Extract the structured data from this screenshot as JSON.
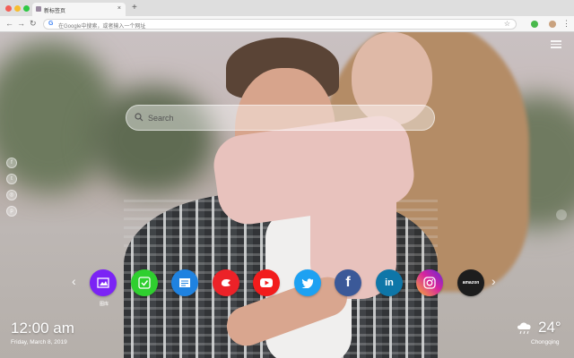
{
  "browser": {
    "tab_title": "新标签页",
    "tab_close": "×",
    "new_tab": "+",
    "back": "←",
    "forward": "→",
    "reload": "↻",
    "omnibox_placeholder": "在Google中搜索，或者输入一个网址",
    "bookmark_star": "☆",
    "menu": "⋮"
  },
  "search": {
    "placeholder": "Search"
  },
  "social_icons": [
    "facebook-icon",
    "twitter-icon",
    "instagram-icon",
    "pinterest-icon"
  ],
  "shortcuts": [
    {
      "icon": "gallery-icon",
      "label": "图库",
      "color": "#7b23f5"
    },
    {
      "icon": "check-app-icon",
      "color": "#2fcf2f"
    },
    {
      "icon": "news-app-icon",
      "color": "#1f82e0"
    },
    {
      "icon": "game-app-icon",
      "color": "#ec2228"
    },
    {
      "icon": "youtube-icon",
      "color": "#f21c1c"
    },
    {
      "icon": "twitter-icon",
      "color": "#1da1f2"
    },
    {
      "icon": "facebook-icon",
      "color": "#3b5998",
      "text": "f"
    },
    {
      "icon": "linkedin-icon",
      "color": "#0e76a8",
      "text": "in"
    },
    {
      "icon": "instagram-icon",
      "color": "#d6249f"
    },
    {
      "icon": "amazon-icon",
      "color": "#1d1d1d",
      "text": "amazon"
    }
  ],
  "nav": {
    "prev": "‹",
    "next": "›"
  },
  "clock": {
    "time": "12:00 am",
    "date": "Friday, March 8, 2019"
  },
  "weather": {
    "icon": "rain-cloud-icon",
    "temperature": "24°",
    "city": "Chongqing"
  }
}
